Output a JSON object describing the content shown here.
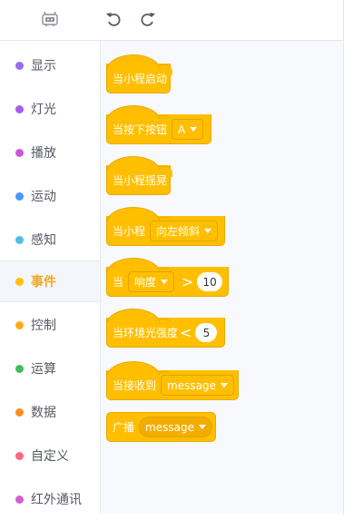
{
  "toolbar": {
    "icons": [
      "robot-icon",
      "undo-icon",
      "redo-icon"
    ]
  },
  "sidebar": {
    "items": [
      {
        "label": "显示",
        "color": "#9b6bf0",
        "active": false
      },
      {
        "label": "灯光",
        "color": "#a65ee8",
        "active": false
      },
      {
        "label": "播放",
        "color": "#c85ad8",
        "active": false
      },
      {
        "label": "运动",
        "color": "#4c97ff",
        "active": false
      },
      {
        "label": "感知",
        "color": "#4cbfe6",
        "active": false
      },
      {
        "label": "事件",
        "color": "#ffbf00",
        "active": true
      },
      {
        "label": "控制",
        "color": "#ffab19",
        "active": false
      },
      {
        "label": "运算",
        "color": "#3fbf5a",
        "active": false
      },
      {
        "label": "数据",
        "color": "#ff8c1a",
        "active": false
      },
      {
        "label": "自定义",
        "color": "#ff6680",
        "active": false
      },
      {
        "label": "红外通讯",
        "color": "#d65cd6",
        "active": false
      }
    ]
  },
  "colors": {
    "event_block": "#ffbf00",
    "event_block_border": "#e8a800",
    "active_category": "#f5a623",
    "canvas_background": "#f7f9fc"
  },
  "blocks": {
    "start_text": "当小程启动",
    "button_prefix": "当按下按钮",
    "button_value": "A",
    "shake_text": "当小程摇晃",
    "tilt_prefix": "当小程",
    "tilt_value": "向左倾斜",
    "loudness_prefix": "当",
    "loudness_value": "响度",
    "loudness_op": ">",
    "loudness_number": "10",
    "light_prefix": "当环境光强度",
    "light_op": "<",
    "light_number": "5",
    "receive_prefix": "当接收到",
    "receive_value": "message",
    "broadcast_prefix": "广播",
    "broadcast_value": "message"
  }
}
